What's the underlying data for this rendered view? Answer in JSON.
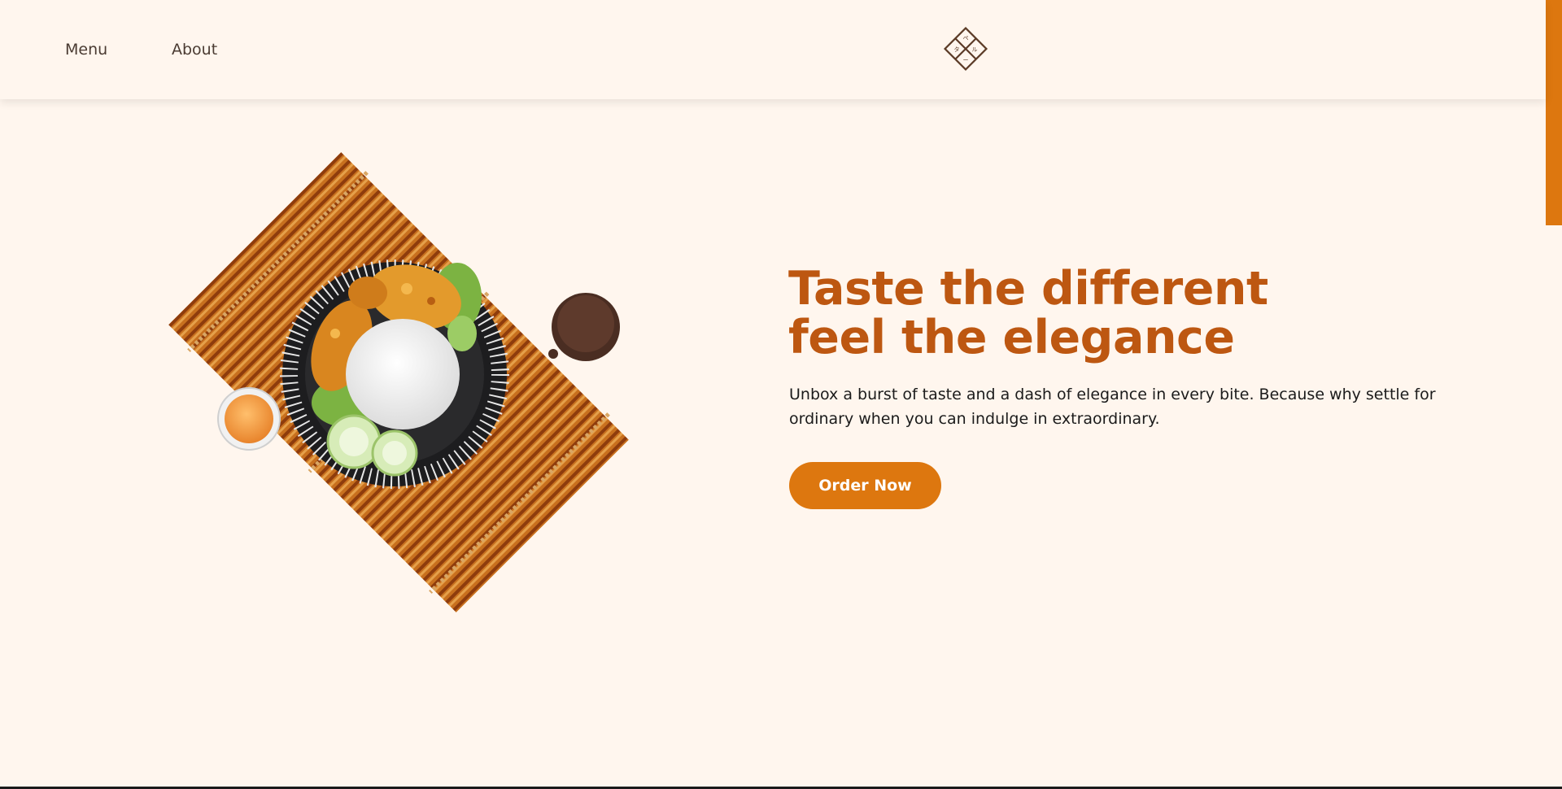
{
  "nav": {
    "menu_label": "Menu",
    "about_label": "About"
  },
  "logo": {
    "icon": "diamond-emblem-icon",
    "glyphs": [
      "ペ",
      "ル",
      "タ",
      "ー"
    ]
  },
  "hero": {
    "title_line1": "Taste the different",
    "title_line2": "feel the elegance",
    "description": "Unbox a burst of taste and a dash of elegance in every bite. Because why settle for ordinary when you can indulge in extraordinary.",
    "cta_label": "Order Now",
    "image": "food-plate-on-bamboo-mat"
  },
  "colors": {
    "background": "#fff6ee",
    "accent": "#dd770f",
    "title": "#bd5711",
    "text": "#1b1b1b"
  }
}
